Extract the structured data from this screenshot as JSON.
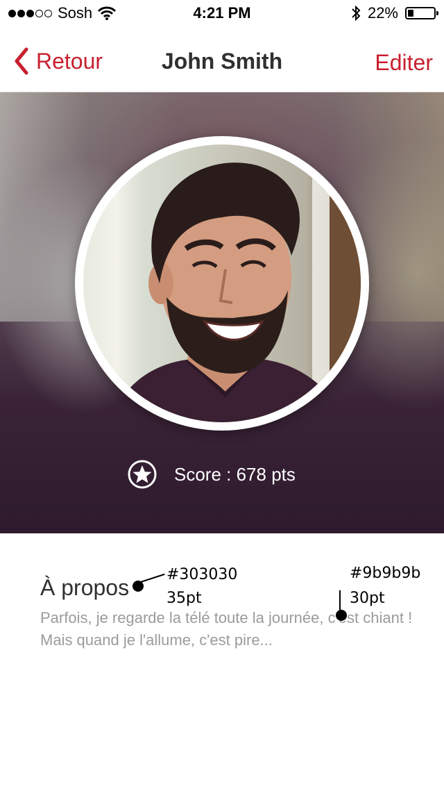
{
  "status_bar": {
    "carrier": "Sosh",
    "time": "4:21 PM",
    "battery_percent": "22%",
    "battery_level": 0.22,
    "signal_bars_filled": 3,
    "signal_bars_total": 5
  },
  "nav": {
    "back_label": "Retour",
    "title": "John Smith",
    "edit_label": "Editer"
  },
  "profile": {
    "score_text": "Score : 678 pts"
  },
  "about": {
    "title": "À propos",
    "text": "Parfois, je regarde la télé toute la journée, c'est chiant ! Mais quand je l'allume, c'est pire..."
  },
  "annotations": {
    "title_color": "#303030",
    "title_size": "35pt",
    "text_color": "#9b9b9b",
    "text_size": "30pt"
  },
  "colors": {
    "accent": "#c8202f",
    "title": "#303030",
    "body_text": "#9b9b9b"
  },
  "icons": [
    "chevron-left-icon",
    "wifi-icon",
    "bluetooth-icon",
    "battery-icon",
    "star-icon"
  ]
}
